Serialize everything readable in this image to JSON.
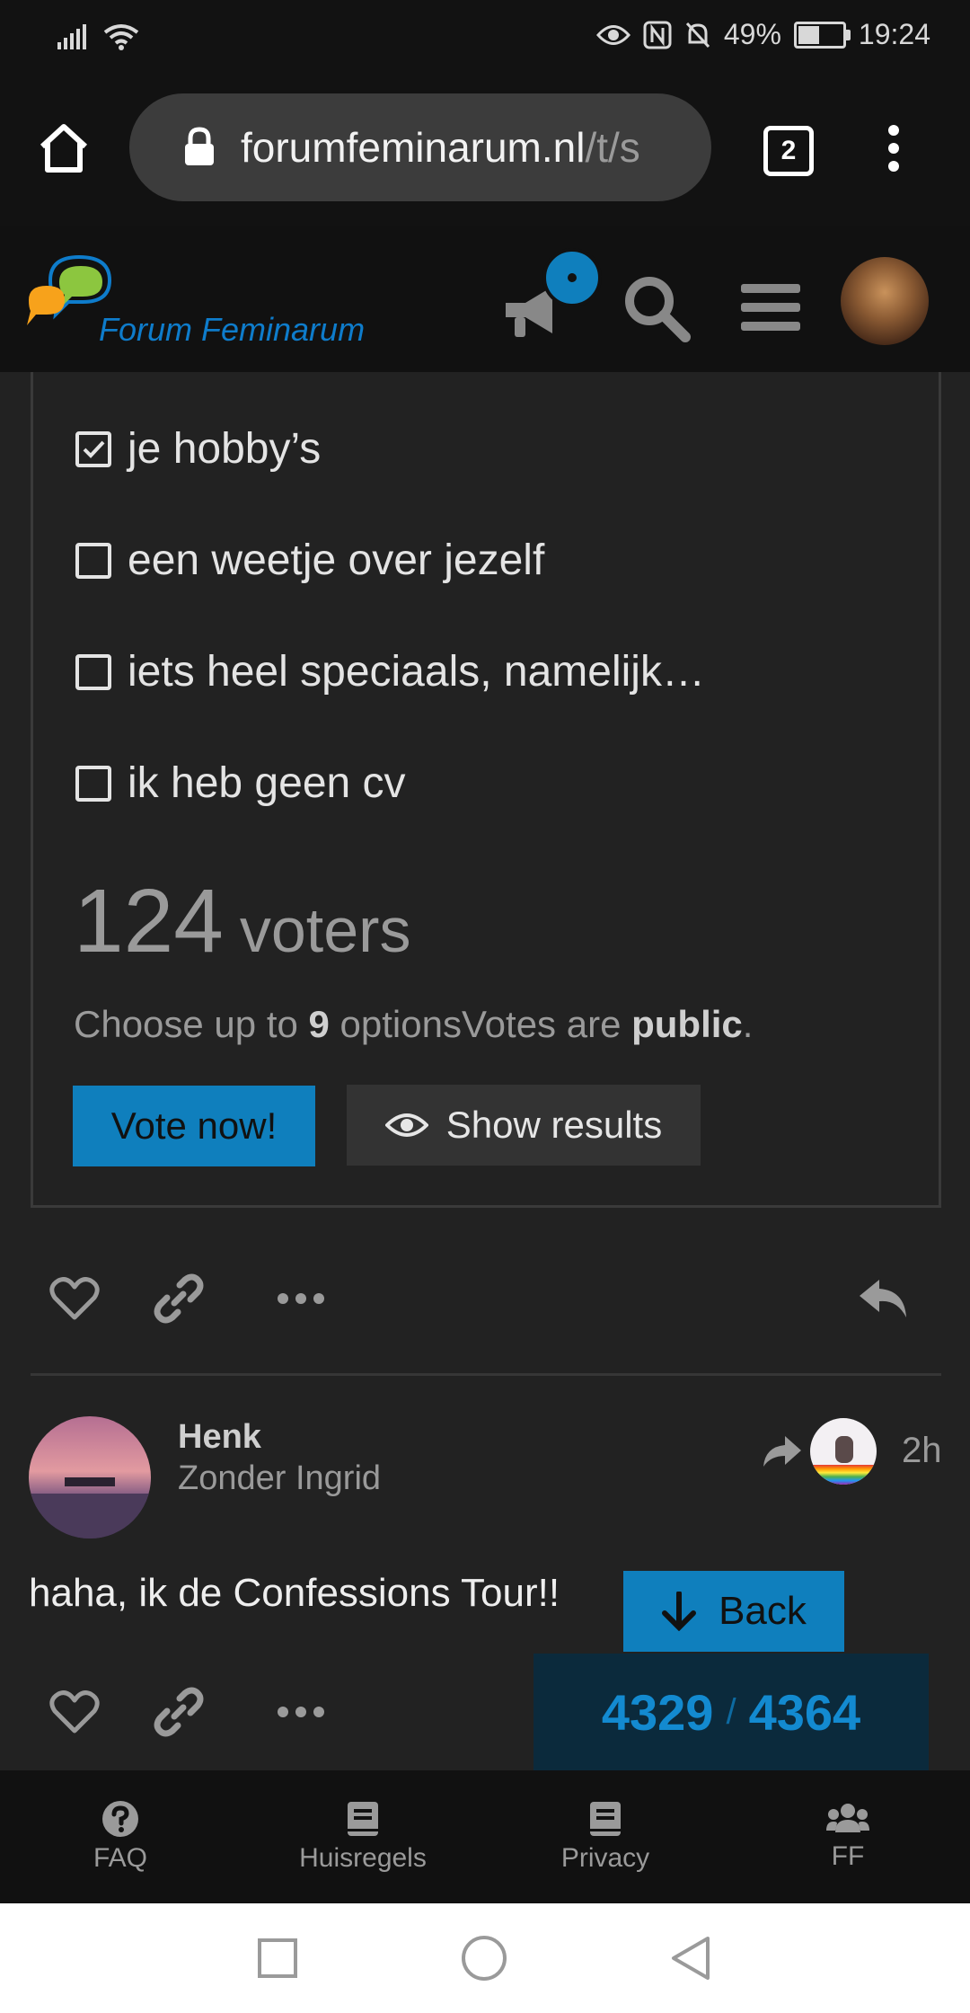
{
  "status_bar": {
    "battery_level": "49%",
    "time": "19:24"
  },
  "browser": {
    "url_host": "forumfeminarum.nl",
    "url_path": "/t/s",
    "tab_count": "2"
  },
  "forum": {
    "name": "Forum Feminarum",
    "accent_color": "#0f7fbd"
  },
  "poll": {
    "options": [
      {
        "label": "je hobby’s",
        "checked": true
      },
      {
        "label": "een weetje over jezelf",
        "checked": false
      },
      {
        "label": "iets heel speciaals, namelijk…",
        "checked": false
      },
      {
        "label": "ik heb geen cv",
        "checked": false
      }
    ],
    "voters_count": "124",
    "voters_label": "voters",
    "info_prefix": "Choose up to ",
    "info_max": "9",
    "info_middle": " optionsVotes are ",
    "info_visibility": "public",
    "info_suffix": ".",
    "vote_button": "Vote now!",
    "show_results_button": "Show results"
  },
  "post": {
    "username": "Henk",
    "user_title": "Zonder Ingrid",
    "time_ago": "2h",
    "text": "haha, ik de Confessions Tour!!"
  },
  "timeline": {
    "back_label": "Back",
    "current": "4329",
    "separator": "/",
    "total": "4364"
  },
  "bottom_nav": [
    {
      "label": "FAQ",
      "icon": "question-circle-icon"
    },
    {
      "label": "Huisregels",
      "icon": "book-icon"
    },
    {
      "label": "Privacy",
      "icon": "book-icon"
    },
    {
      "label": "FF",
      "icon": "users-icon"
    }
  ]
}
